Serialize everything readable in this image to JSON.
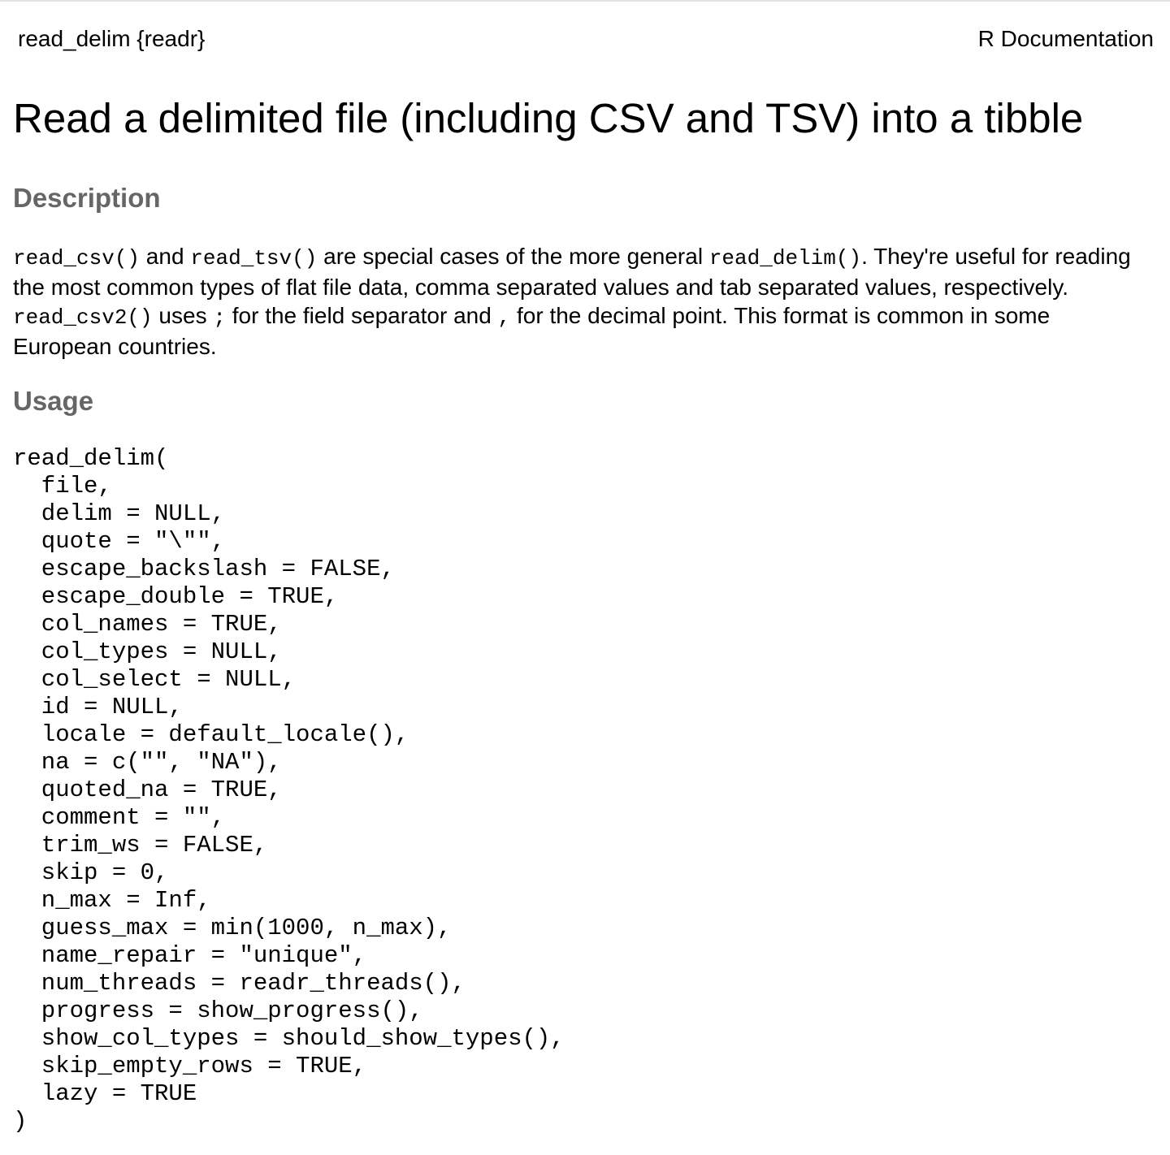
{
  "header": {
    "topic": "read_delim {readr}",
    "doc_label": "R Documentation"
  },
  "title": "Read a delimited file (including CSV and TSV) into a tibble",
  "description": {
    "heading": "Description",
    "code_read_csv": "read_csv()",
    "text_and": " and ",
    "code_read_tsv": "read_tsv()",
    "text_special": " are special cases of the more general ",
    "code_read_delim": "read_delim()",
    "text_useful": ". They're useful for reading the most common types of flat file data, comma separated values and tab separated values, respectively. ",
    "code_read_csv2": "read_csv2()",
    "text_uses": " uses ",
    "code_semicolon": ";",
    "text_field_sep": " for the field separator and ",
    "code_comma": ",",
    "text_decimal": " for the decimal point. This format is common in some European countries."
  },
  "usage": {
    "heading": "Usage",
    "lines": [
      "read_delim(",
      "  file,",
      "  delim = NULL,",
      "  quote = \"\\\"\",",
      "  escape_backslash = FALSE,",
      "  escape_double = TRUE,",
      "  col_names = TRUE,",
      "  col_types = NULL,",
      "  col_select = NULL,",
      "  id = NULL,",
      "  locale = default_locale(),",
      "  na = c(\"\", \"NA\"),",
      "  quoted_na = TRUE,",
      "  comment = \"\",",
      "  trim_ws = FALSE,",
      "  skip = 0,",
      "  n_max = Inf,",
      "  guess_max = min(1000, n_max),",
      "  name_repair = \"unique\",",
      "  num_threads = readr_threads(),",
      "  progress = show_progress(),",
      "  show_col_types = should_show_types(),",
      "  skip_empty_rows = TRUE,",
      "  lazy = TRUE",
      ")"
    ]
  }
}
